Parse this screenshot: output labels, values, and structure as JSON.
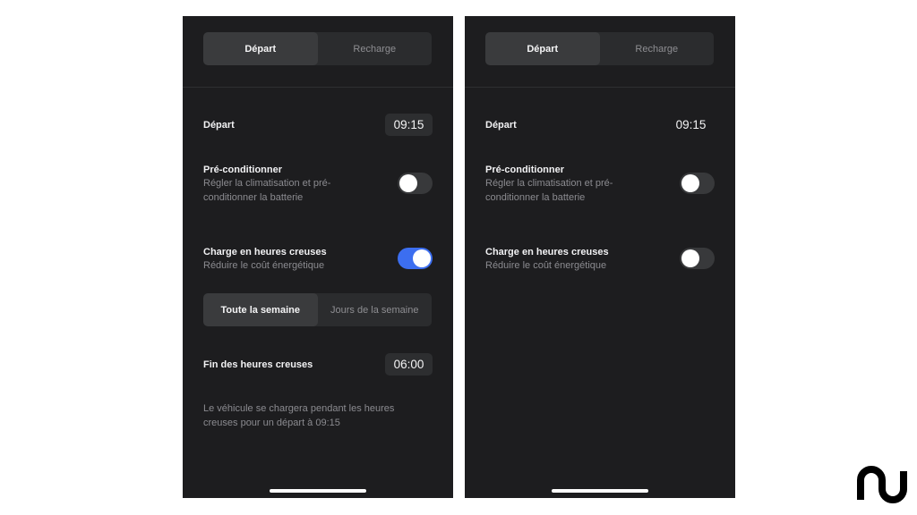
{
  "screens": [
    {
      "tabs": [
        "Départ",
        "Recharge"
      ],
      "departure": {
        "label": "Départ",
        "time": "09:15"
      },
      "precondition": {
        "title": "Pré-conditionner",
        "subtitle": "Régler la climatisation et pré-conditionner la batterie",
        "enabled": false
      },
      "offpeak": {
        "title": "Charge en heures creuses",
        "subtitle": "Réduire le coût énergétique",
        "enabled": true
      },
      "schedule_tabs": [
        "Toute la semaine",
        "Jours de la semaine"
      ],
      "offpeak_end": {
        "label": "Fin des heures creuses",
        "time": "06:00"
      },
      "info": "Le véhicule se chargera pendant les heures creuses pour un départ à 09:15"
    },
    {
      "tabs": [
        "Départ",
        "Recharge"
      ],
      "departure": {
        "label": "Départ",
        "time": "09:15"
      },
      "precondition": {
        "title": "Pré-conditionner",
        "subtitle": "Régler la climatisation et pré-conditionner la batterie",
        "enabled": false
      },
      "offpeak": {
        "title": "Charge en heures creuses",
        "subtitle": "Réduire le coût énergétique",
        "enabled": false
      }
    }
  ],
  "colors": {
    "toggle_on": "#3c6ef0",
    "background": "#1d1d1f"
  },
  "logo_icon": "brand-logo-icon"
}
